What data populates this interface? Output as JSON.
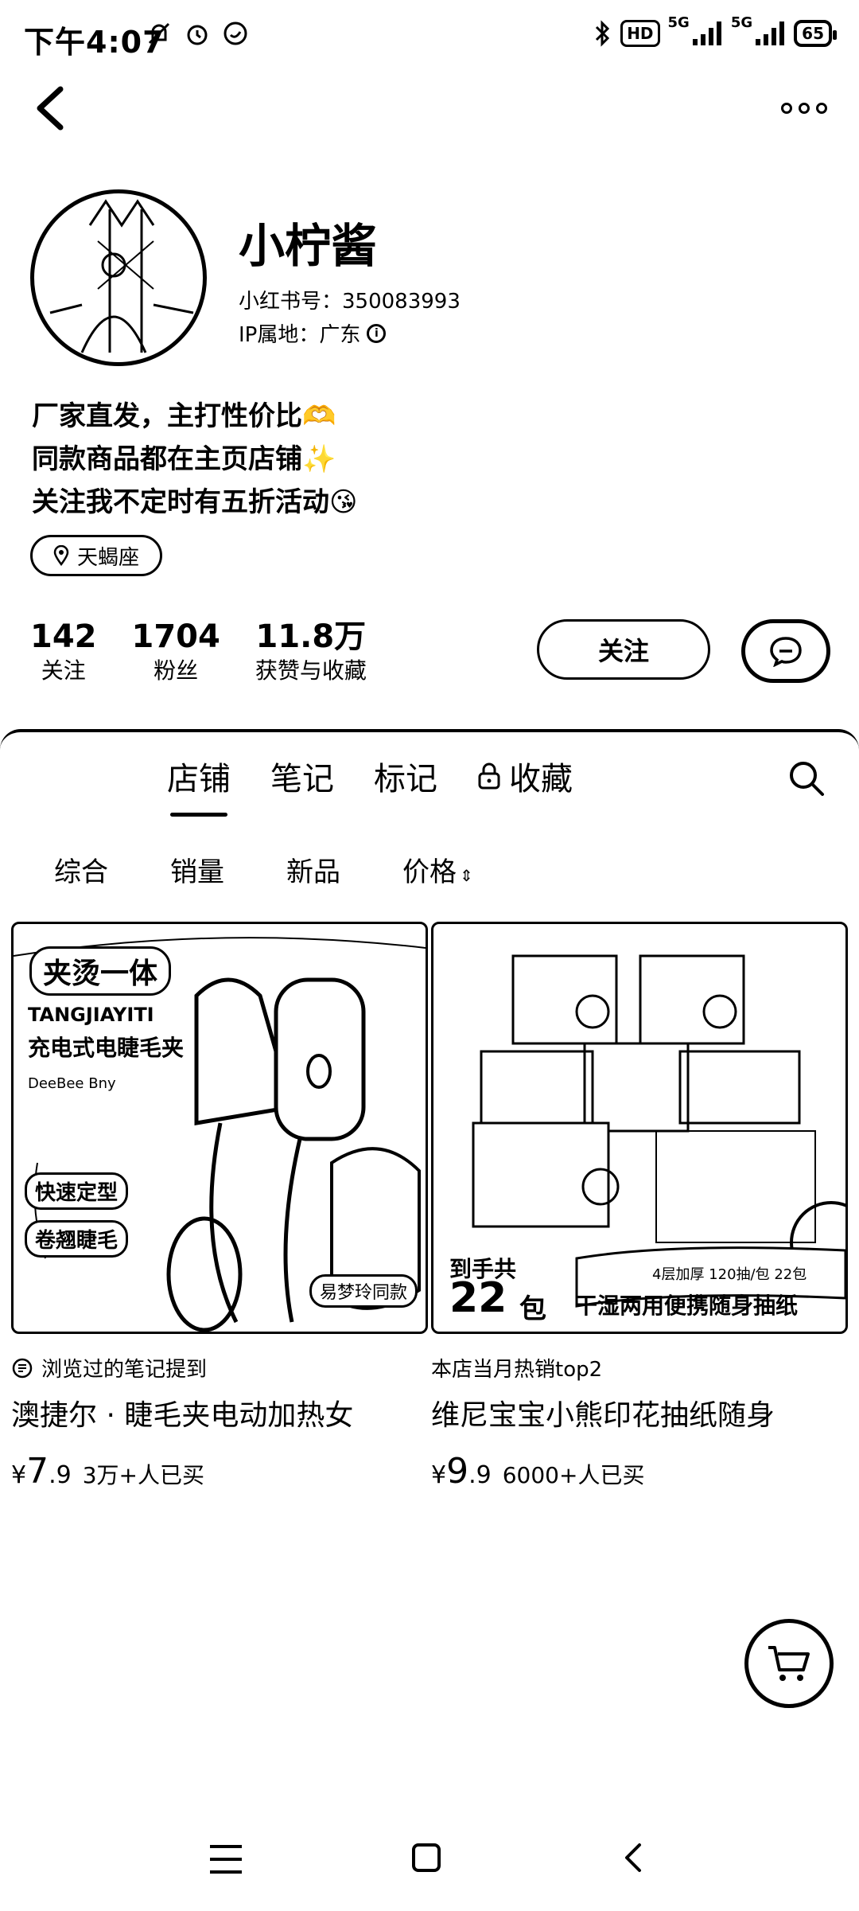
{
  "status_bar": {
    "time": "下午4:07",
    "hd_label": "HD",
    "signal_label_1": "5G",
    "signal_label_2": "5G",
    "battery": "65"
  },
  "profile": {
    "nickname": "小柠酱",
    "red_id": "小红书号：350083993",
    "ip_location": "IP属地：广东",
    "bio_lines": [
      "厂家直发，主打性价比🫶",
      "同款商品都在主页店铺✨",
      "关注我不定时有五折活动😘"
    ],
    "tag": "天蝎座",
    "stats": [
      {
        "num": "142",
        "label": "关注"
      },
      {
        "num": "1704",
        "label": "粉丝"
      },
      {
        "num": "11.8万",
        "label": "获赞与收藏"
      }
    ],
    "follow_label": "关注"
  },
  "tabs": [
    {
      "label": "店铺",
      "active": true
    },
    {
      "label": "笔记",
      "active": false
    },
    {
      "label": "标记",
      "active": false
    },
    {
      "label": "收藏",
      "active": false
    }
  ],
  "filters": [
    "综合",
    "销量",
    "新品",
    "价格"
  ],
  "products": [
    {
      "image_texts": {
        "badge": "夹烫一体",
        "pinyin": "TANGJIAYITI",
        "subtitle": "充电式电睫毛夹",
        "brand": "DeeBee Bny",
        "check_1": "快速定型",
        "check_2": "卷翘睫毛",
        "tag": "易梦玲同款"
      },
      "meta": "浏览过的笔记提到",
      "title": "澳捷尔 · 睫毛夹电动加热女",
      "currency": "¥",
      "price_int": "7",
      "price_dec": ".9",
      "sold": "3万+人已买"
    },
    {
      "image_texts": {
        "arrive": "到手共",
        "count": "22",
        "unit": "包",
        "spec": "4层加厚 120抽/包 22包",
        "banner": "干湿两用便携随身抽纸"
      },
      "meta": "本店当月热销top2",
      "title": "维尼宝宝小熊印花抽纸随身",
      "currency": "¥",
      "price_int": "9",
      "price_dec": ".9",
      "sold": "6000+人已买"
    }
  ]
}
